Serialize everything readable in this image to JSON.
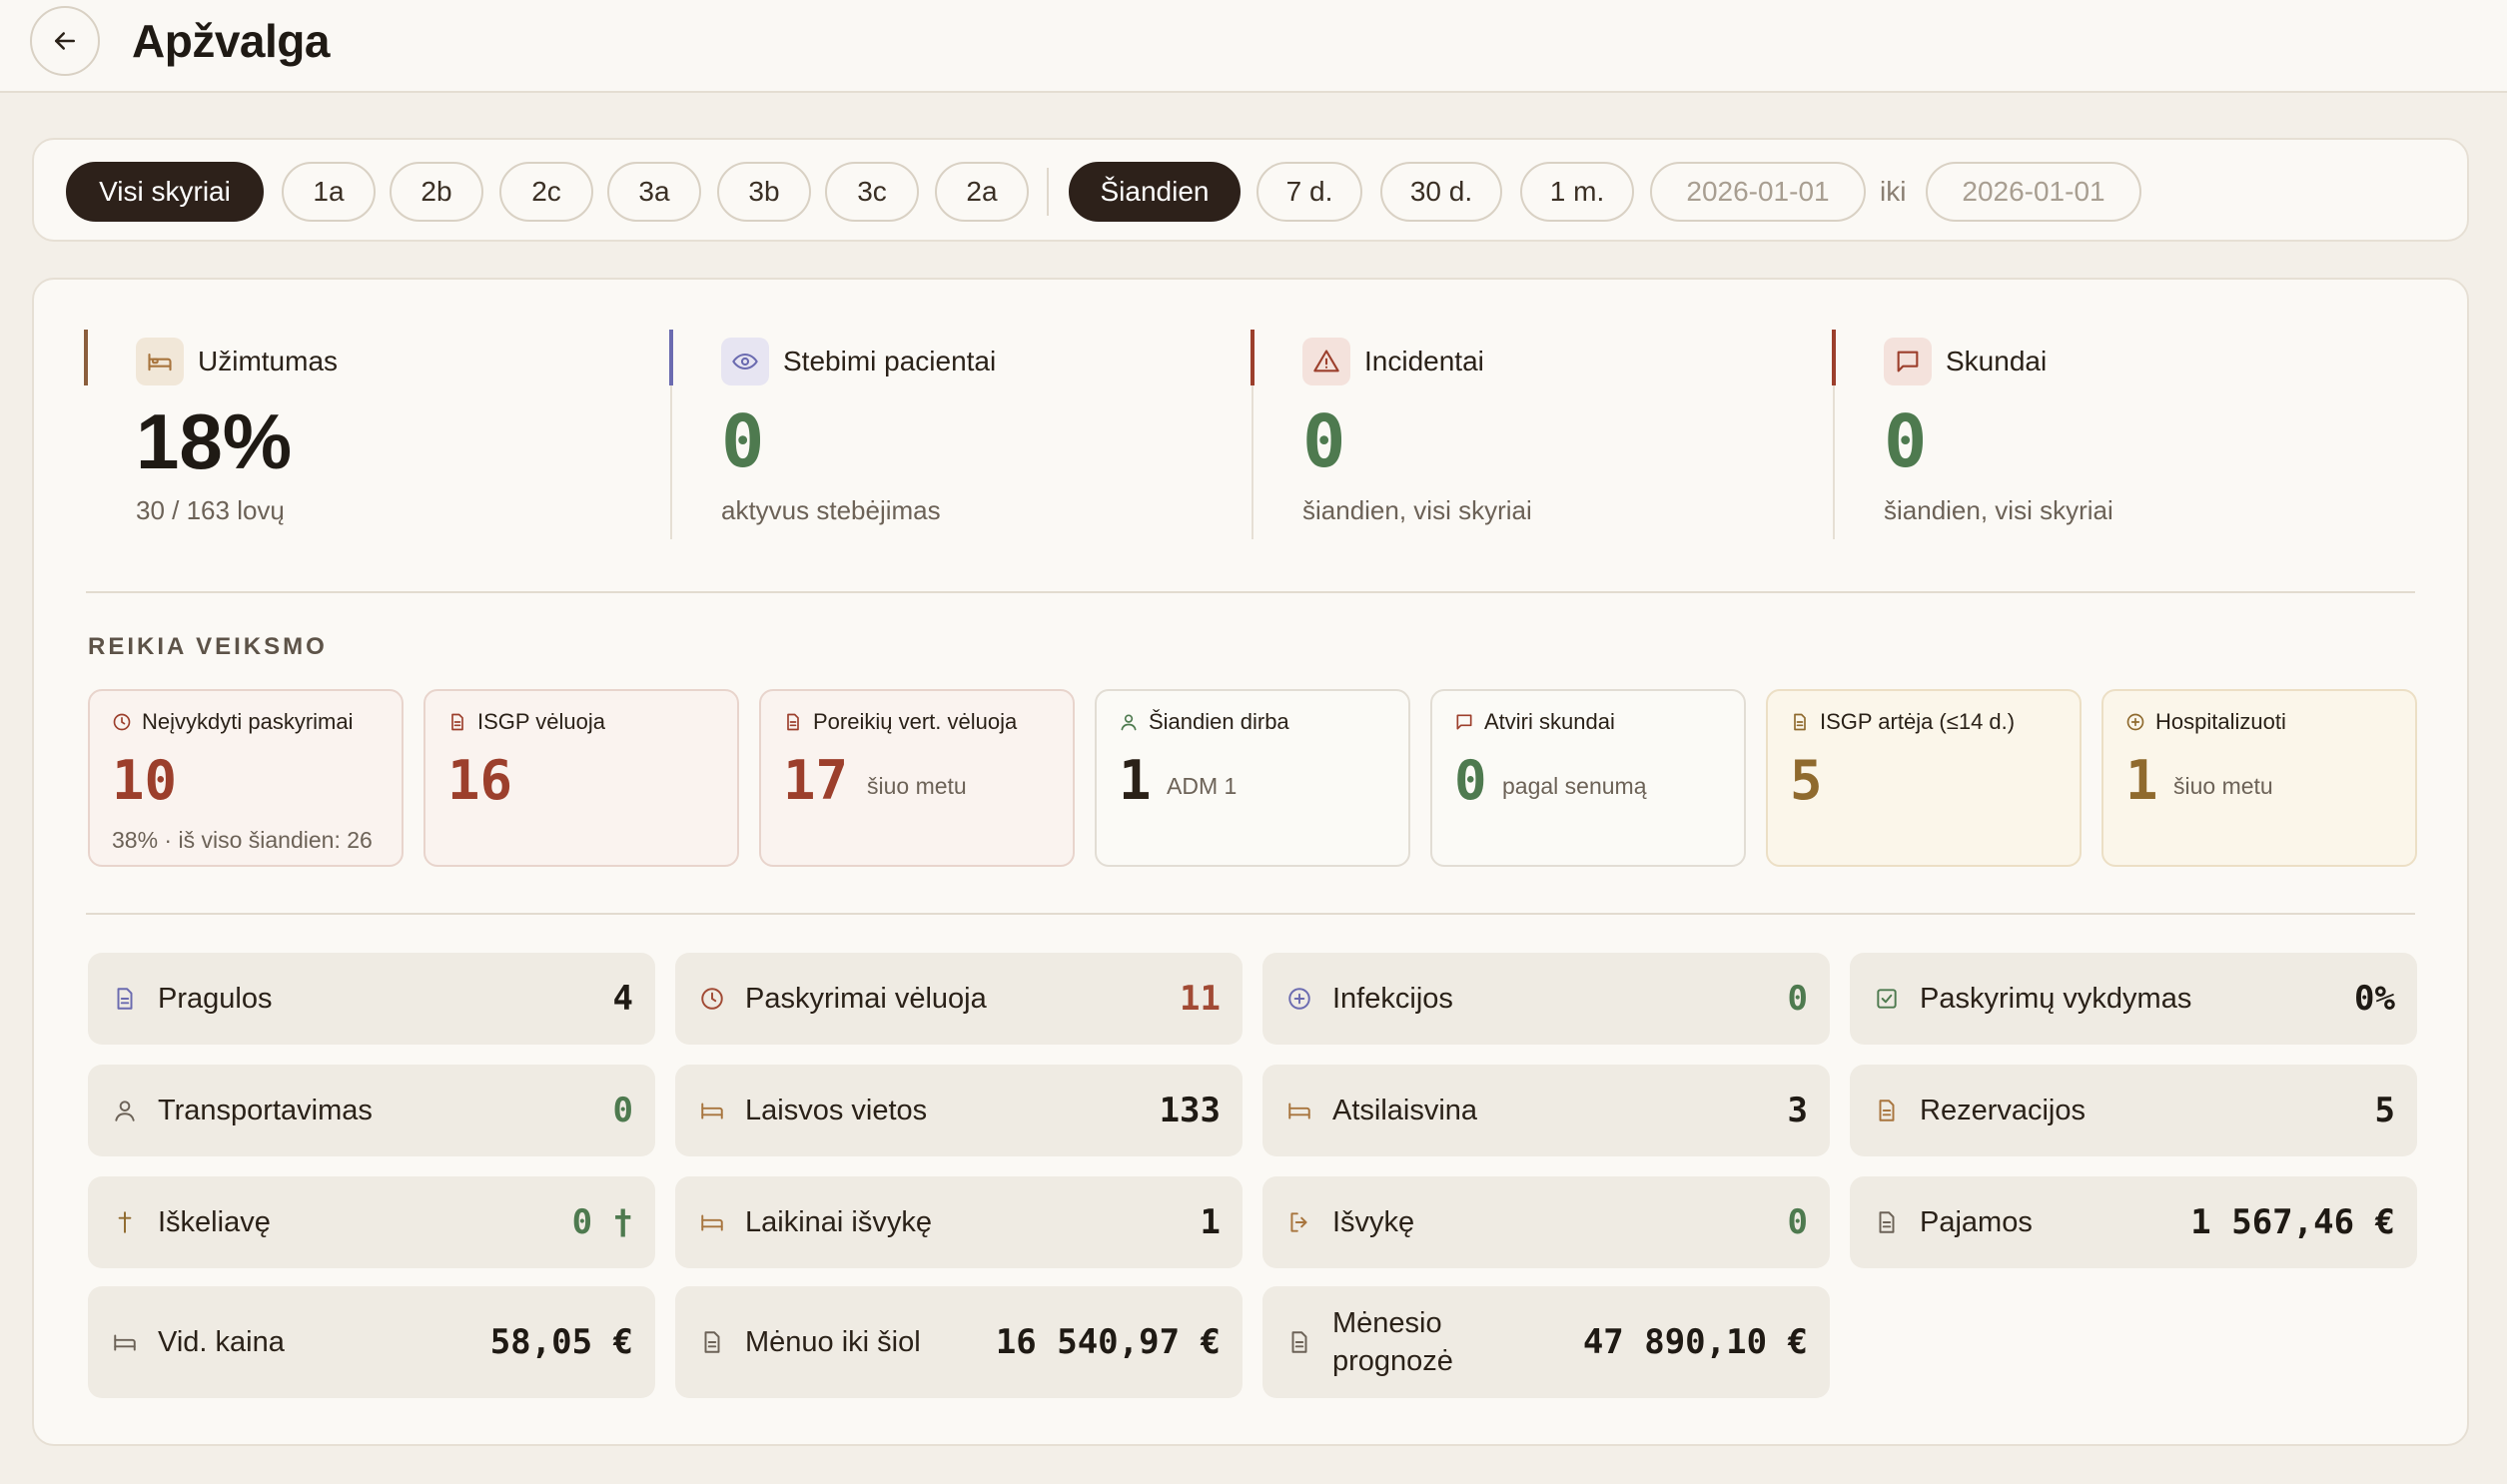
{
  "header": {
    "title": "Apžvalga"
  },
  "filters": {
    "departments": [
      "Visi skyriai",
      "1a",
      "2b",
      "2c",
      "3a",
      "3b",
      "3c",
      "2a"
    ],
    "active_department": "Visi skyriai",
    "periods": [
      "Šiandien",
      "7 d.",
      "30 d.",
      "1 m."
    ],
    "active_period": "Šiandien",
    "date_from": "2026-01-01",
    "date_sep": "iki",
    "date_to": "2026-01-01"
  },
  "kpis": [
    {
      "label": "Užimtumas",
      "value": "18%",
      "sub": "30 / 163 lovų",
      "accent": "#8b5e3c"
    },
    {
      "label": "Stebimi pacientai",
      "value": "0",
      "sub": "aktyvus stebėjimas",
      "accent": "#6b6bb0"
    },
    {
      "label": "Incidentai",
      "value": "0",
      "sub": "šiandien, visi skyriai",
      "accent": "#9c3f2c"
    },
    {
      "label": "Skundai",
      "value": "0",
      "sub": "šiandien, visi skyriai",
      "accent": "#9c3f2c"
    }
  ],
  "action": {
    "title": "REIKIA VEIKSMO",
    "cards": [
      {
        "label": "Neįvykdyti paskyrimai",
        "value": "10",
        "sub": "38% · iš viso šiandien: 26"
      },
      {
        "label": "ISGP vėluoja",
        "value": "16"
      },
      {
        "label": "Poreikių vert. vėluoja",
        "value": "17",
        "inline": "šiuo metu"
      },
      {
        "label": "Šiandien dirba",
        "value": "1",
        "inline": "ADM 1"
      },
      {
        "label": "Atviri skundai",
        "value": "0",
        "inline": "pagal senumą"
      },
      {
        "label": "ISGP artėja (≤14 d.)",
        "value": "5"
      },
      {
        "label": "Hospitalizuoti",
        "value": "1",
        "inline": "šiuo metu"
      }
    ]
  },
  "tiles": [
    {
      "label": "Pragulos",
      "value": "4"
    },
    {
      "label": "Paskyrimai vėluoja",
      "value": "11"
    },
    {
      "label": "Infekcijos",
      "value": "0"
    },
    {
      "label": "Paskyrimų vykdymas",
      "value": "0%"
    },
    {
      "label": "Transportavimas",
      "value": "0"
    },
    {
      "label": "Laisvos vietos",
      "value": "133"
    },
    {
      "label": "Atsilaisvina",
      "value": "3"
    },
    {
      "label": "Rezervacijos",
      "value": "5"
    },
    {
      "label": "Iškeliavę",
      "value": "0 †"
    },
    {
      "label": "Laikinai išvykę",
      "value": "1"
    },
    {
      "label": "Išvykę",
      "value": "0"
    },
    {
      "label": "Pajamos",
      "value": "1 567,46 €"
    },
    {
      "label": "Vid. kaina",
      "value": "58,05 €"
    },
    {
      "label": "Mėnuo iki šiol",
      "value": "16 540,97 €"
    },
    {
      "label": "Mėnesio prognozė",
      "value": "47 890,10 €"
    }
  ]
}
